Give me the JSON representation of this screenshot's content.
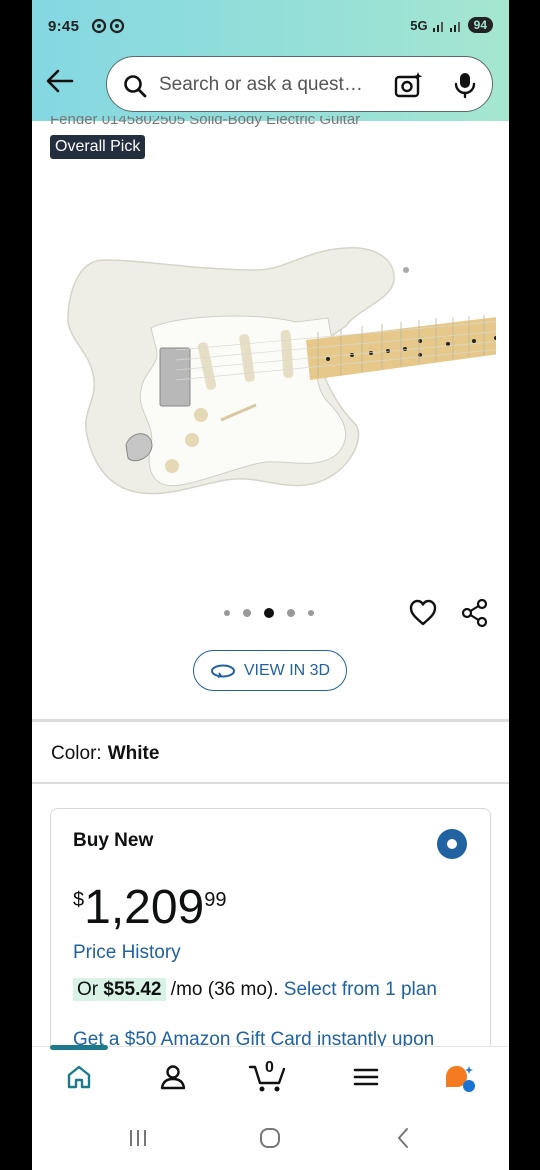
{
  "status_bar": {
    "time": "9:45",
    "network": "5G",
    "battery": "94"
  },
  "search": {
    "placeholder": "Search or ask a quest…"
  },
  "breadcrumb": "Fender 0145802505 Solid-Body Electric Guitar",
  "badge": "Overall Pick",
  "carousel": {
    "count": 5,
    "active_index": 2
  },
  "view_3d_label": "VIEW IN 3D",
  "color": {
    "label": "Color:",
    "value": "White"
  },
  "buy_box": {
    "title": "Buy New",
    "price": {
      "currency": "$",
      "whole": "1,209",
      "fraction": "99"
    },
    "price_history": "Price History",
    "monthly": {
      "prefix": "Or ",
      "amount": "$55.42",
      "suffix": " /mo (36 mo). ",
      "link": "Select from 1 plan"
    },
    "gift_card_text": "Get a $50 Amazon Gift Card instantly upon"
  },
  "bottom_nav": {
    "cart_count": "0",
    "items": [
      "home-icon",
      "account-icon",
      "cart-icon",
      "menu-icon",
      "rufus-icon"
    ]
  },
  "colors": {
    "accent": "#2162a1",
    "topbar_start": "#84d8e2",
    "topbar_end": "#a5e6cf",
    "badge_bg": "#232f3e",
    "nav_indicator": "#1c7a8c"
  }
}
